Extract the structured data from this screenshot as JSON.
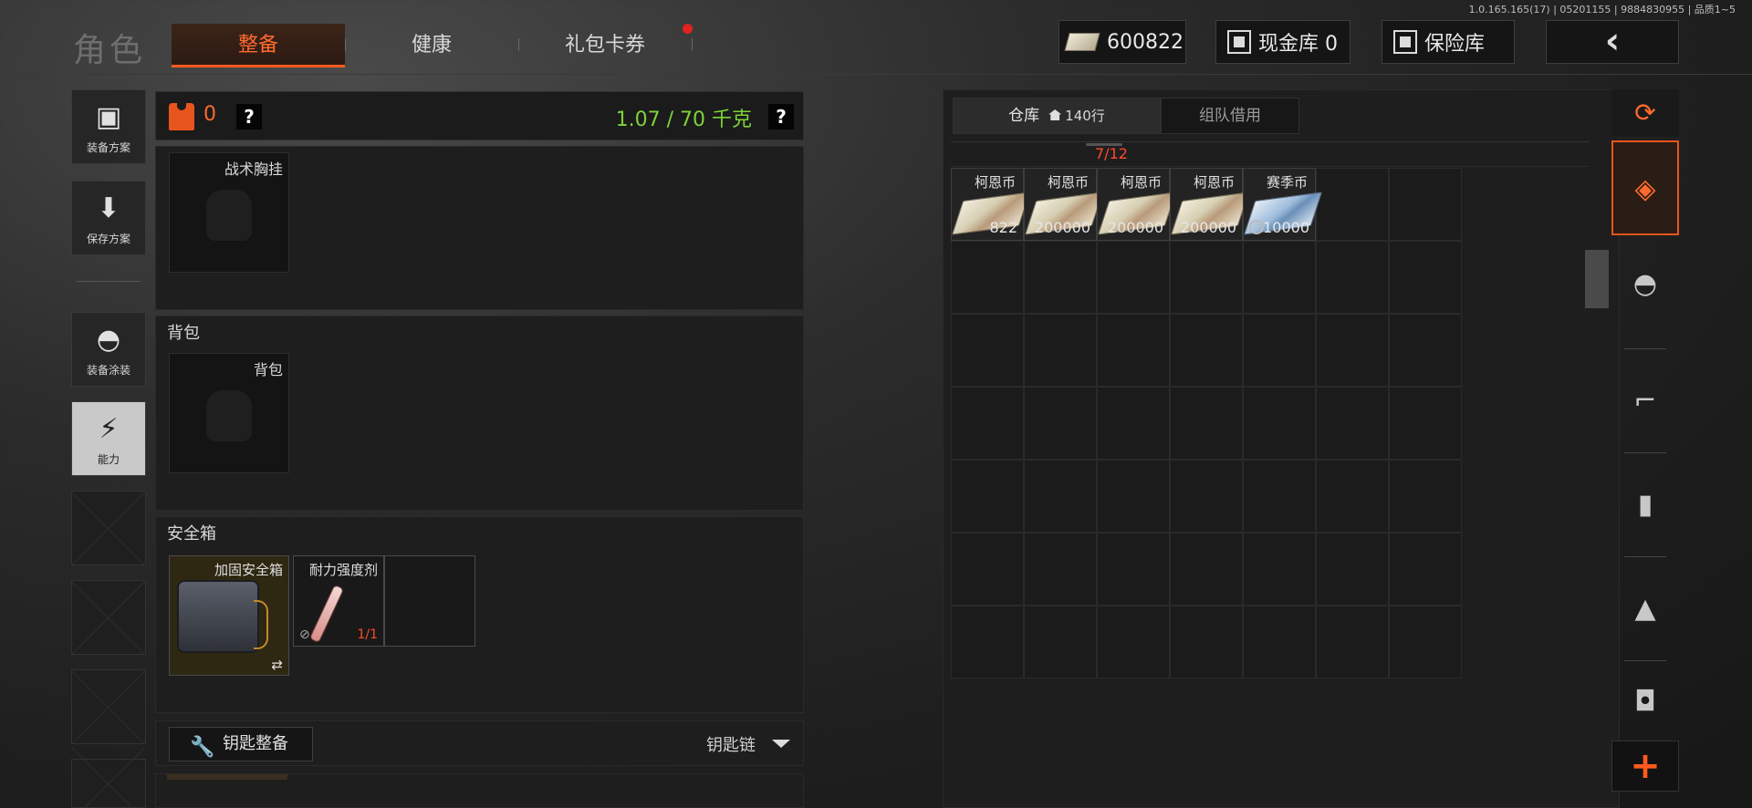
{
  "version": "1.0.165.165(17) | 05201155 | 9884830955 | 品质1~5",
  "header": {
    "title": "角色",
    "tabs": [
      {
        "label": "整备",
        "active": true
      },
      {
        "label": "健康",
        "active": false
      },
      {
        "label": "礼包卡券",
        "active": false,
        "notification": true
      }
    ],
    "currency": "600822",
    "cash_vault": "现金库 0",
    "safe_vault": "保险库",
    "back_icon": "chevron-left-icon"
  },
  "sidebar": {
    "items": [
      {
        "label": "装备方案",
        "icon": "vest-icon"
      },
      {
        "label": "保存方案",
        "icon": "download-icon"
      },
      {
        "label": "装备涂装",
        "icon": "helmet-icon"
      },
      {
        "label": "能力",
        "icon": "lightning-icon"
      }
    ]
  },
  "loadout": {
    "vest_count": "0",
    "help": "?",
    "weight": "1.07 / 70 千克",
    "chest_rig": {
      "slot_label": "战术胸挂"
    },
    "backpack": {
      "title": "背包",
      "slot_label": "背包"
    },
    "safe_box": {
      "title": "安全箱",
      "items": [
        {
          "name": "加固安全箱",
          "swap": "⇄"
        },
        {
          "name": "耐力强度剂",
          "count": "1/1"
        }
      ]
    },
    "keys": {
      "button": "钥匙整备",
      "chain": "钥匙链"
    }
  },
  "warehouse": {
    "tabs": [
      {
        "label": "仓库",
        "sub": "140行",
        "active": true
      },
      {
        "label": "组队借用",
        "active": false
      }
    ],
    "capacity": "7/12",
    "items": [
      {
        "name": "柯恩币",
        "qty": "822",
        "color": "#e6ddc2"
      },
      {
        "name": "柯恩币",
        "qty": "200000",
        "color": "#e6ddc2"
      },
      {
        "name": "柯恩币",
        "qty": "200000",
        "color": "#e6ddc2"
      },
      {
        "name": "柯恩币",
        "qty": "200000",
        "color": "#e6ddc2"
      },
      {
        "name": "赛季币",
        "qty": "10000",
        "color": "#9dbcdb"
      }
    ]
  },
  "categories": [
    "layers-refresh-icon",
    "layers-download-icon",
    "helmet-icon",
    "rifle-icon",
    "magazine-icon",
    "bullet-icon",
    "scope-icon"
  ],
  "colors": {
    "accent": "#ff5a1e",
    "weight_ok": "#7ed23a",
    "alert_red": "#ff4a2a"
  }
}
